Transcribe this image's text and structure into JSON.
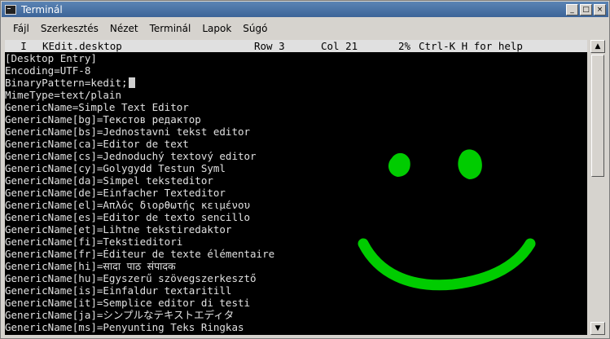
{
  "window": {
    "title": "Terminál"
  },
  "titlebar_buttons": {
    "minimize": "_",
    "maximize": "□",
    "close": "×"
  },
  "menu": [
    "Fájl",
    "Szerkesztés",
    "Nézet",
    "Terminál",
    "Lapok",
    "Súgó"
  ],
  "status_bar": {
    "mode": "I",
    "filename": "KEdit.desktop",
    "row": "Row 3",
    "col": "Col 21",
    "percent": "2%",
    "help": "Ctrl-K H for help"
  },
  "lines": [
    "[Desktop Entry]",
    "Encoding=UTF-8",
    "BinaryPattern=kedit;",
    "MimeType=text/plain",
    "GenericName=Simple Text Editor",
    "GenericName[bg]=Текстов редактор",
    "GenericName[bs]=Jednostavni tekst editor",
    "GenericName[ca]=Editor de text",
    "GenericName[cs]=Jednoduchý textový editor",
    "GenericName[cy]=Golygydd Testun Syml",
    "GenericName[da]=Simpel teksteditor",
    "GenericName[de]=Einfacher Texteditor",
    "GenericName[el]=Απλός διορθωτής κειμένου",
    "GenericName[es]=Editor de texto sencillo",
    "GenericName[et]=Lihtne tekstiredaktor",
    "GenericName[fi]=Tekstieditori",
    "GenericName[fr]=Éditeur de texte élémentaire",
    "GenericName[hi]=सादा पाठ संपादक",
    "GenericName[hu]=Egyszerű szövegszerkesztő",
    "GenericName[is]=Einfaldur textaritill",
    "GenericName[it]=Semplice editor di testi",
    "GenericName[ja]=シンプルなテキストエディタ",
    "GenericName[ms]=Penyunting Teks Ringkas"
  ],
  "colors": {
    "terminal_bg": "#000000",
    "terminal_fg": "#e0e0e0",
    "smiley": "#00cc00",
    "titlebar": "#4a73a8"
  }
}
